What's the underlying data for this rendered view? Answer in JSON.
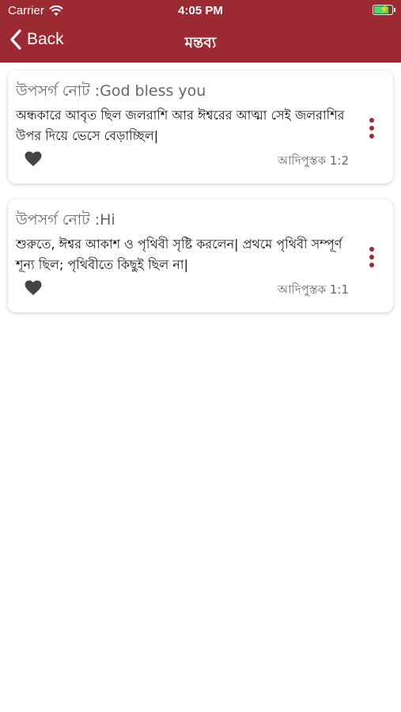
{
  "status_bar": {
    "carrier": "Carrier",
    "time": "4:05 PM",
    "battery_level": 0.9
  },
  "nav": {
    "back_label": "Back",
    "title": "মন্তব্য"
  },
  "notes": [
    {
      "title": "উপসর্গ নোট :God bless you",
      "body": "অন্ধকারে আবৃত ছিল জলরাশি আর ঈশ্বরের আত্মা সেই জলরাশির উপর দিয়ে ভেসে বেড়াচ্ছিল|",
      "reference": "আদিপুস্তক  1:2"
    },
    {
      "title": "উপসর্গ নোট :Hi",
      "body": "শুরুতে, ঈশ্বর আকাশ ও পৃথিবী সৃষ্টি করলেন| প্রথমে পৃথিবী সম্পূর্ণ শূন্য ছিল; পৃথিবীতে কিছুই ছিল না|",
      "reference": "আদিপুস্তক  1:1"
    }
  ],
  "colors": {
    "brand": "#9b2a32",
    "battery_charging": "#4cd964"
  }
}
